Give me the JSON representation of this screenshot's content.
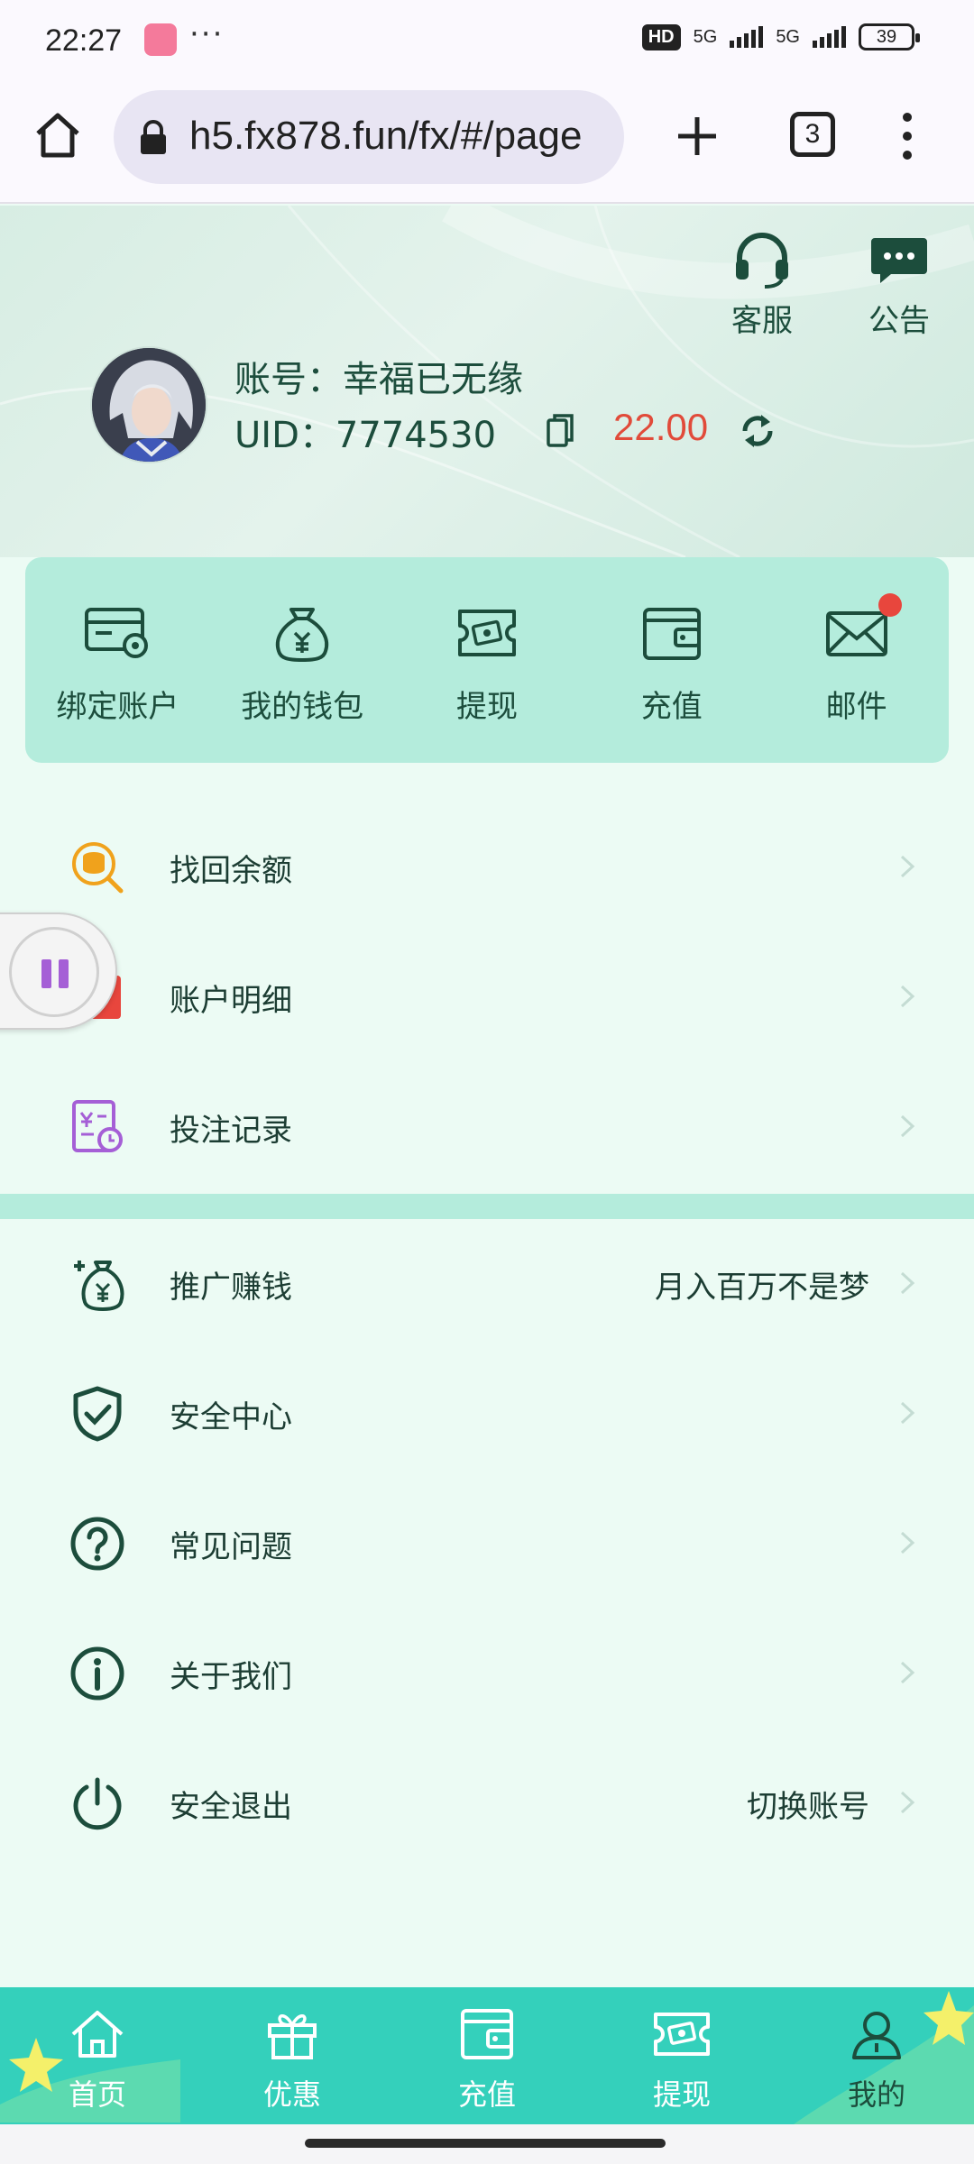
{
  "status_bar": {
    "time": "22:27",
    "dots": "···",
    "hd": "HD",
    "net1": "5G",
    "net2": "5G",
    "battery": "39"
  },
  "browser": {
    "url": "h5.fx878.fun/fx/#/page",
    "tab_count": "3"
  },
  "header": {
    "service_label": "客服",
    "notice_label": "公告",
    "account_line": "账号：幸福已无缘",
    "uid_line": "UID：7774530",
    "balance": "22.00"
  },
  "quick_actions": [
    {
      "label": "绑定账户",
      "icon": "card-settings-icon"
    },
    {
      "label": "我的钱包",
      "icon": "money-bag-icon"
    },
    {
      "label": "提现",
      "icon": "withdraw-ticket-icon"
    },
    {
      "label": "充值",
      "icon": "wallet-icon"
    },
    {
      "label": "邮件",
      "icon": "mail-icon",
      "has_badge": true
    }
  ],
  "menu_group_1": [
    {
      "label": "找回余额",
      "icon": "coin-search-icon"
    },
    {
      "label": "账户明细",
      "icon": "account-detail-icon"
    },
    {
      "label": "投注记录",
      "icon": "bet-record-icon"
    }
  ],
  "menu_group_2": [
    {
      "label": "推广赚钱",
      "value": "月入百万不是梦",
      "icon": "promo-money-icon"
    },
    {
      "label": "安全中心",
      "value": "",
      "icon": "shield-check-icon"
    },
    {
      "label": "常见问题",
      "value": "",
      "icon": "question-icon"
    },
    {
      "label": "关于我们",
      "value": "",
      "icon": "info-icon"
    },
    {
      "label": "安全退出",
      "value": "切换账号",
      "icon": "power-icon"
    }
  ],
  "bottom_nav": [
    {
      "label": "首页",
      "icon": "home-icon"
    },
    {
      "label": "优惠",
      "icon": "gift-icon"
    },
    {
      "label": "充值",
      "icon": "wallet-icon"
    },
    {
      "label": "提现",
      "icon": "withdraw-ticket-icon"
    },
    {
      "label": "我的",
      "icon": "user-icon",
      "active": true
    }
  ],
  "colors": {
    "accent": "#34d0bb",
    "panel": "#b4ecdc",
    "dark_green": "#1c4d3c",
    "balance_red": "#e14b3a",
    "badge_red": "#e8463d"
  }
}
